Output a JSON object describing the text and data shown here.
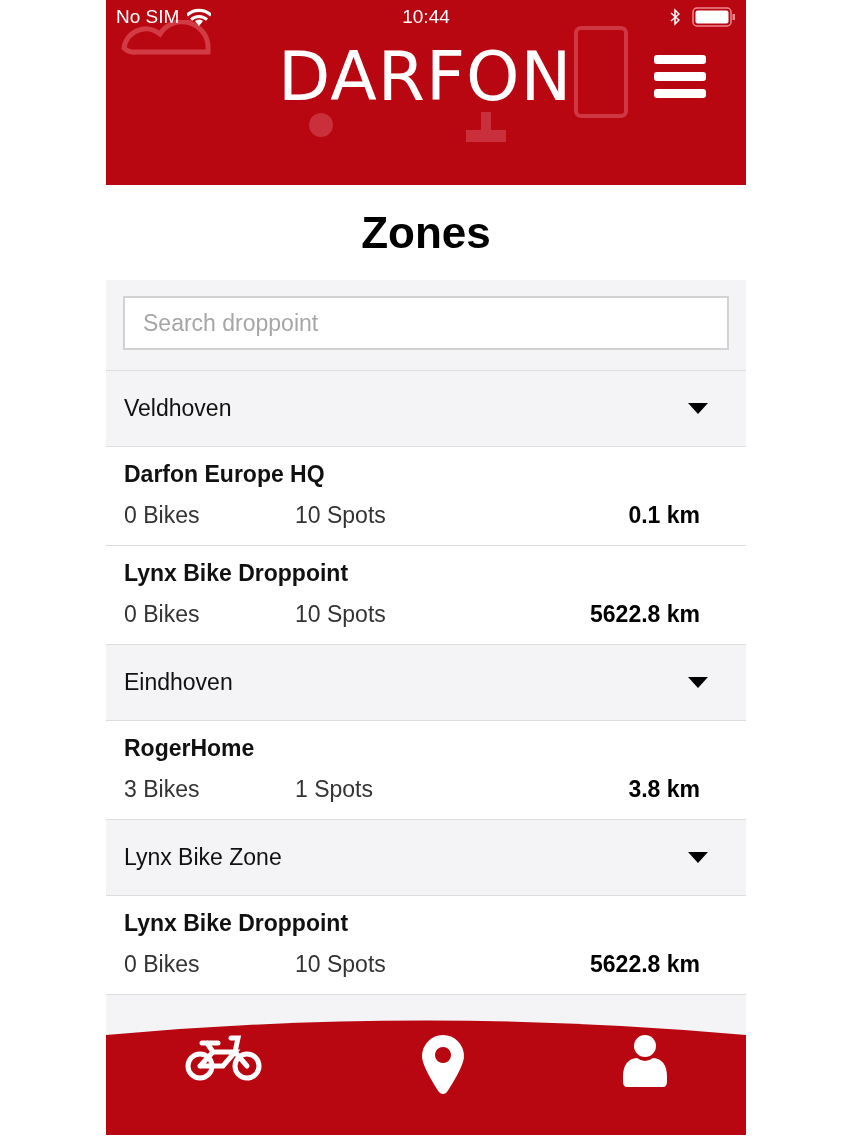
{
  "status_bar": {
    "carrier": "No SIM",
    "time": "10:44"
  },
  "header": {
    "logo": "DARFON"
  },
  "title": "Zones",
  "search": {
    "placeholder": "Search droppoint"
  },
  "groups": [
    {
      "name": "Veldhoven",
      "expanded": true,
      "droppoints": [
        {
          "name": "Darfon Europe HQ",
          "bikes": "0 Bikes",
          "spots": "10 Spots",
          "distance": "0.1 km"
        },
        {
          "name": "Lynx Bike Droppoint",
          "bikes": "0 Bikes",
          "spots": "10 Spots",
          "distance": "5622.8 km"
        }
      ]
    },
    {
      "name": "Eindhoven",
      "expanded": true,
      "droppoints": [
        {
          "name": "RogerHome",
          "bikes": "3 Bikes",
          "spots": "1 Spots",
          "distance": "3.8 km"
        }
      ]
    },
    {
      "name": "Lynx Bike Zone",
      "expanded": true,
      "droppoints": [
        {
          "name": "Lynx Bike Droppoint",
          "bikes": "0 Bikes",
          "spots": "10 Spots",
          "distance": "5622.8 km"
        }
      ]
    }
  ],
  "nav": [
    {
      "kind": "bike"
    },
    {
      "kind": "pin"
    },
    {
      "kind": "user"
    }
  ]
}
